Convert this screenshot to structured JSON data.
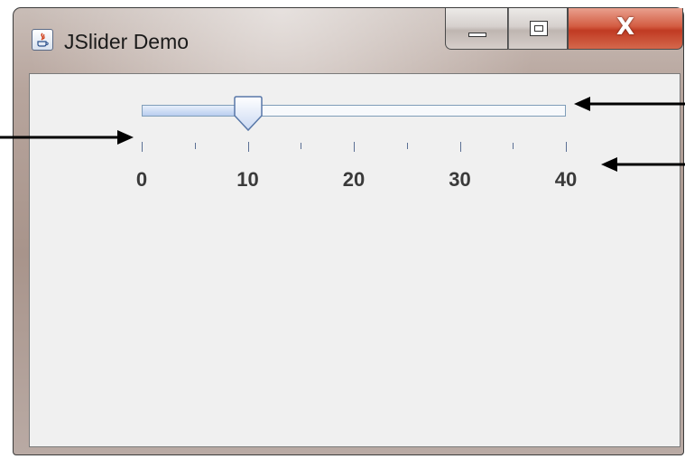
{
  "window": {
    "title": "JSlider Demo",
    "caption_buttons": {
      "minimize_icon": "minimize-icon",
      "maximize_icon": "maximize-icon",
      "close_label": "X"
    }
  },
  "slider": {
    "min": 0,
    "max": 40,
    "value": 10,
    "major_tick_spacing": 10,
    "minor_tick_spacing": 5,
    "labels": [
      "0",
      "10",
      "20",
      "30",
      "40"
    ]
  },
  "colors": {
    "track_border": "#7f9db9",
    "tick": "#5a6f94",
    "label": "#3a3a3a",
    "arrow": "#000000"
  }
}
